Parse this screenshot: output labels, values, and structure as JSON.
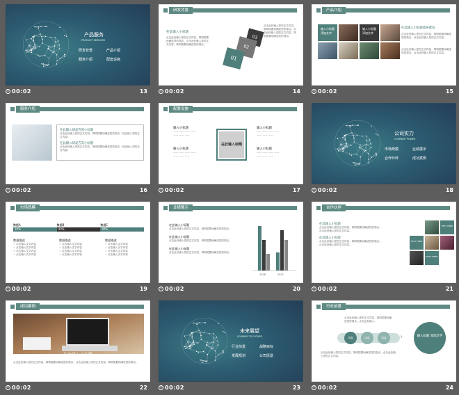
{
  "slides": [
    {
      "time": "00:02",
      "num": "13",
      "title": "产品服务",
      "sub": "PRODUCT SERVICES",
      "items": [
        "研发背景",
        "产品介绍",
        "服务介绍",
        "配套设施"
      ]
    },
    {
      "time": "00:02",
      "num": "14",
      "header": "研发背景",
      "heading": "在此输入小标题",
      "body": "点击此处输入您的正文内容，简明扼要地阐述您的观点。点击此处输入您的正文内容，简明扼要地阐述您的观点。",
      "blocks": [
        "03",
        "02",
        "01"
      ]
    },
    {
      "time": "00:02",
      "num": "15",
      "header": "产品介绍",
      "boxes": [
        "输入小标题 添加文字",
        "输入小标题 添加文字"
      ],
      "heading": "在此输入小标题或关键词",
      "body": "点击此处输入您的正文内容，简明扼要地阐述您的观点。点击此处输入您的正文内容。"
    },
    {
      "time": "00:02",
      "num": "16",
      "header": "服务介绍",
      "items": [
        "在此输入研发方向小标题",
        "在此输入研发方向小标题"
      ],
      "body": "点击此处输入您的正文内容，简明扼要地阐述您的观点（在此输入您的正文内容）"
    },
    {
      "time": "00:02",
      "num": "17",
      "header": "配套设施",
      "center": "在此输入标题",
      "labels": [
        "输入小标题",
        "输入小标题",
        "输入小标题",
        "输入小标题"
      ]
    },
    {
      "time": "00:02",
      "num": "18",
      "title": "公司实力",
      "sub": "COMPANY POWER",
      "items": [
        "市场规模",
        "业绩展示",
        "合作伙伴",
        "成功案例"
      ]
    },
    {
      "time": "00:02",
      "num": "19",
      "header": "市场规模",
      "bars": [
        {
          "label": "数据A",
          "pct": "20%"
        },
        {
          "label": "数据B",
          "pct": "40%"
        },
        {
          "label": "数据C",
          "pct": "40%"
        }
      ],
      "cols": [
        "数据描述",
        "数据描述",
        "数据描述"
      ]
    },
    {
      "time": "00:02",
      "num": "20",
      "header": "业绩展示",
      "items": [
        "在此输入小标题",
        "在此输入小标题",
        "在此输入小标题"
      ],
      "years": [
        "2016",
        "2017"
      ]
    },
    {
      "time": "00:02",
      "num": "21",
      "header": "合作伙伴",
      "headings": [
        "在此输入小标题",
        "在此输入小标题"
      ],
      "tiles": [
        "TEXT HERE",
        "TEXT HERE",
        "TEXT HERE"
      ]
    },
    {
      "time": "00:02",
      "num": "22",
      "header": "成功案例",
      "caption": "在此输入小标题",
      "body": "点击此处输入您的正文内容，简明扼要地阐述您的观点。点击此处输入您的正文内容，简明扼要地阐述您的观点。"
    },
    {
      "time": "00:02",
      "num": "23",
      "title": "未来展望",
      "sub": "LOOKING TO FUTURE",
      "items": [
        "行业前景",
        "战略目标",
        "发展规划",
        "公司愿景"
      ]
    },
    {
      "time": "00:02",
      "num": "24",
      "header": "行业前景",
      "circles": [
        "内容",
        "内容",
        "内容"
      ],
      "big": "输入标题 添加文字"
    }
  ],
  "colors": {
    "accent": "#5f8a84",
    "dark_bg": "#2c5b70",
    "page_bg": "#5d5d5d"
  }
}
